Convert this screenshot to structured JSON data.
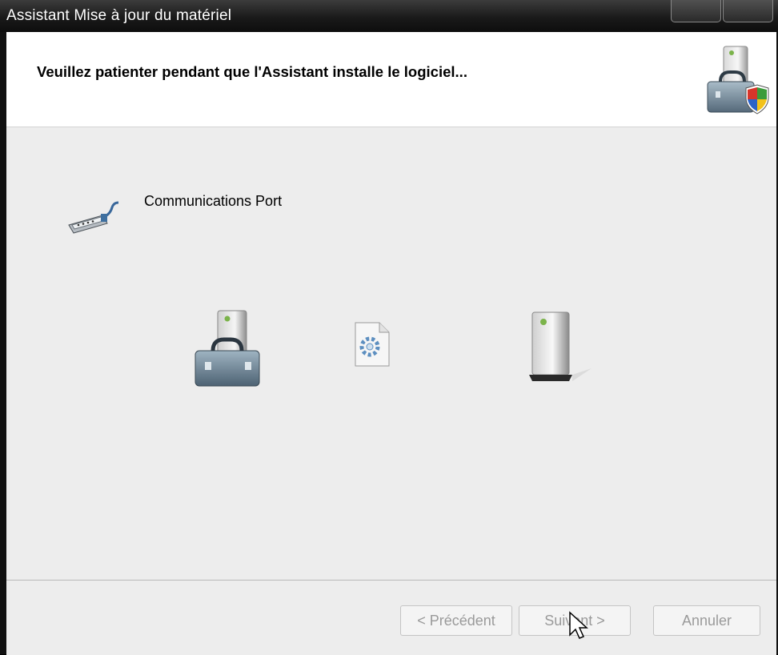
{
  "window": {
    "title": "Assistant Mise à jour du matériel"
  },
  "header": {
    "title": "Veuillez patienter pendant que l'Assistant installe le logiciel..."
  },
  "content": {
    "device_name": "Communications Port"
  },
  "footer": {
    "prev_label": "< Précédent",
    "next_label": "Suivant >",
    "cancel_label": "Annuler"
  },
  "icons": {
    "header": "toolbox-shield-icon",
    "device": "communications-port-icon",
    "source": "toolbox-computer-icon",
    "transfer": "setup-file-icon",
    "target": "computer-icon"
  },
  "colors": {
    "titlebar": "#1a1a1a",
    "header_bg": "#ffffff",
    "content_bg": "#ededed",
    "disabled_text": "#9a9a9a"
  }
}
